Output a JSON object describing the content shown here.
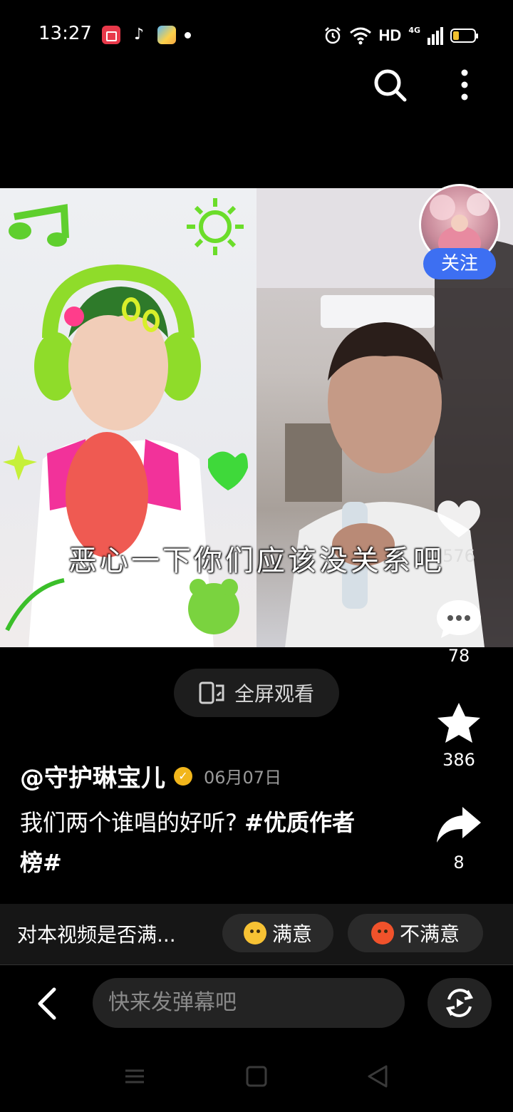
{
  "status_bar": {
    "time": "13:27",
    "tiktok_glyph": "♪",
    "network": "HD",
    "network_gen": "4G"
  },
  "video": {
    "subtitle": "恶心一下你们应该没关系吧"
  },
  "follow_label": "关注",
  "actions": {
    "like_count": "576",
    "comment_count": "78",
    "favorite_count": "386",
    "share_count": "8"
  },
  "fullscreen_label": "全屏观看",
  "post": {
    "author": "@守护琳宝儿",
    "date": "06月07日",
    "caption_text": "我们两个谁唱的好听? ",
    "caption_tag": "#优质作者榜#"
  },
  "survey": {
    "question": "对本视频是否满...",
    "good_label": "满意",
    "bad_label": "不满意"
  },
  "danmaku": {
    "placeholder": "快来发弹幕吧"
  },
  "colors": {
    "follow": "#3d6ff2",
    "verified": "#f2b61b",
    "battery": "#f2c12e"
  }
}
